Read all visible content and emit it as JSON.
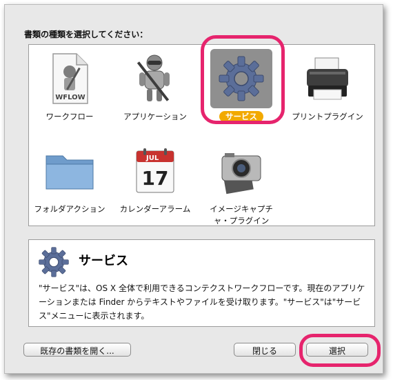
{
  "dialog": {
    "prompt": "書類の種類を選択してください："
  },
  "types": [
    {
      "label": "ワークフロー",
      "icon": "workflow-document-icon",
      "badge": "WFLOW"
    },
    {
      "label": "アプリケーション",
      "icon": "automator-robot-icon"
    },
    {
      "label": "サービス",
      "icon": "gear-icon",
      "selected": true
    },
    {
      "label": "プリントプラグイン",
      "icon": "printer-icon"
    },
    {
      "label": "フォルダアクション",
      "icon": "folder-icon"
    },
    {
      "label": "カレンダーアラーム",
      "icon": "calendar-icon",
      "month": "JUL",
      "day": "17"
    },
    {
      "label": "イメージキャプチャ・プラグイン",
      "icon": "camera-icon"
    }
  ],
  "description": {
    "title": "サービス",
    "text": "\"サービス\"は、OS X 全体で利用できるコンテクストワークフローです。現在のアプリケーションまたは Finder からテキストやファイルを受け取ります。\"サービス\"は\"サービス\"メニューに表示されます。"
  },
  "buttons": {
    "open_existing": "既存の書類を開く...",
    "close": "閉じる",
    "choose": "選択"
  },
  "colors": {
    "highlight": "#e6246d",
    "selected_badge": "#f2a900",
    "gear": "#5b6e99"
  }
}
